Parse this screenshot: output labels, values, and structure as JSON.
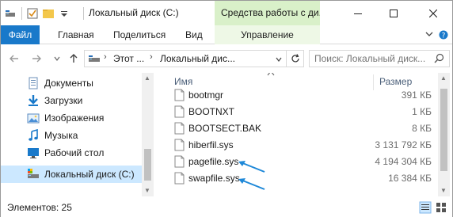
{
  "window": {
    "title": "Локальный диск (C:)",
    "context_group": "Средства работы с ди..."
  },
  "ribbon": {
    "tabs": [
      "Файл",
      "Главная",
      "Поделиться",
      "Вид",
      "Управление"
    ]
  },
  "address": {
    "crumbs": [
      "Этот ...",
      "Локальный дис..."
    ],
    "search_placeholder": "Поиск: Локальный диск..."
  },
  "nav": {
    "items": [
      {
        "label": "Документы",
        "icon": "documents-icon"
      },
      {
        "label": "Загрузки",
        "icon": "downloads-icon"
      },
      {
        "label": "Изображения",
        "icon": "pictures-icon"
      },
      {
        "label": "Музыка",
        "icon": "music-icon"
      },
      {
        "label": "Рабочий стол",
        "icon": "desktop-icon"
      },
      {
        "label": "Локальный диск (C:)",
        "icon": "local-disk-icon",
        "selected": true
      }
    ]
  },
  "files": {
    "columns": {
      "name": "Имя",
      "size": "Размер"
    },
    "rows": [
      {
        "name": "bootmgr",
        "size": "391 КБ"
      },
      {
        "name": "BOOTNXT",
        "size": "1 КБ"
      },
      {
        "name": "BOOTSECT.BAK",
        "size": "8 КБ"
      },
      {
        "name": "hiberfil.sys",
        "size": "3 131 792 КБ"
      },
      {
        "name": "pagefile.sys",
        "size": "4 194 304 КБ"
      },
      {
        "name": "swapfile.sys",
        "size": "16 384 КБ"
      }
    ]
  },
  "status": {
    "count": "Элементов: 25"
  },
  "colors": {
    "file_tab": "#1979ca",
    "context_tab": "#d9f0c9",
    "selection": "#cce8ff",
    "annotation_arrow": "#1e88d8"
  }
}
